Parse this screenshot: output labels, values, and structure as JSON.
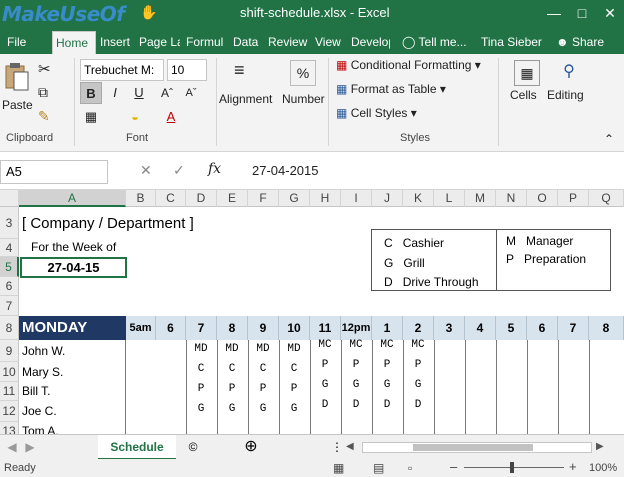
{
  "window": {
    "watermark": "MakeUseOf",
    "title": "shift-schedule.xlsx - Excel",
    "user": "Tina Sieber",
    "share": "Share",
    "tell_me": "Tell me..."
  },
  "tabs": [
    "File",
    "Home",
    "Insert",
    "Page La",
    "Formul",
    "Data",
    "Review",
    "View",
    "Develop"
  ],
  "ribbon": {
    "clipboard": {
      "paste": "Paste",
      "label": "Clipboard"
    },
    "font": {
      "name": "Trebuchet M:",
      "size": "10",
      "bold": "B",
      "italic": "I",
      "underline": "U",
      "label": "Font"
    },
    "alignment": "Alignment",
    "number": "Number",
    "styles": {
      "conditional": "Conditional Formatting",
      "format_table": "Format as Table",
      "cell_styles": "Cell Styles",
      "label": "Styles"
    },
    "cells": "Cells",
    "editing": "Editing"
  },
  "formula_bar": {
    "name_box": "A5",
    "value": "27-04-2015",
    "fx": "fx"
  },
  "columns": [
    "A",
    "B",
    "C",
    "D",
    "E",
    "F",
    "G",
    "H",
    "I",
    "J",
    "K",
    "L",
    "M",
    "N",
    "O",
    "P",
    "Q"
  ],
  "rows": [
    "3",
    "4",
    "5",
    "6",
    "7",
    "8",
    "9",
    "10",
    "11",
    "12",
    "13"
  ],
  "sheet": {
    "company": "[ Company / Department ]",
    "week_label": "For the Week of",
    "week_value": "27-04-15",
    "legend": [
      {
        "code": "C",
        "label": "Cashier"
      },
      {
        "code": "G",
        "label": "Grill"
      },
      {
        "code": "D",
        "label": "Drive Through"
      },
      {
        "code": "M",
        "label": "Manager"
      },
      {
        "code": "P",
        "label": "Preparation"
      }
    ],
    "day": "MONDAY",
    "hours": [
      "5am",
      "6",
      "7",
      "8",
      "9",
      "10",
      "11",
      "12pm",
      "1",
      "2",
      "3",
      "4",
      "5",
      "6",
      "7",
      "8"
    ],
    "employees": [
      "John W.",
      "Mary S.",
      "Bill T.",
      "Joe C.",
      "Tom A."
    ],
    "shifts": [
      [
        "MD",
        "C",
        "P",
        "G"
      ],
      [
        "MD",
        "C",
        "P",
        "G"
      ],
      [
        "MD",
        "C",
        "P",
        "G"
      ],
      [
        "MD",
        "C",
        "P",
        "G"
      ],
      [
        "MC",
        "P",
        "G",
        "D"
      ],
      [
        "MC",
        "P",
        "G",
        "D"
      ],
      [
        "MC",
        "P",
        "G",
        "D"
      ],
      [
        "MC",
        "P",
        "G",
        "D"
      ]
    ]
  },
  "sheet_tabs": [
    "Schedule",
    "©"
  ],
  "status": {
    "ready": "Ready",
    "zoom": "100%"
  }
}
